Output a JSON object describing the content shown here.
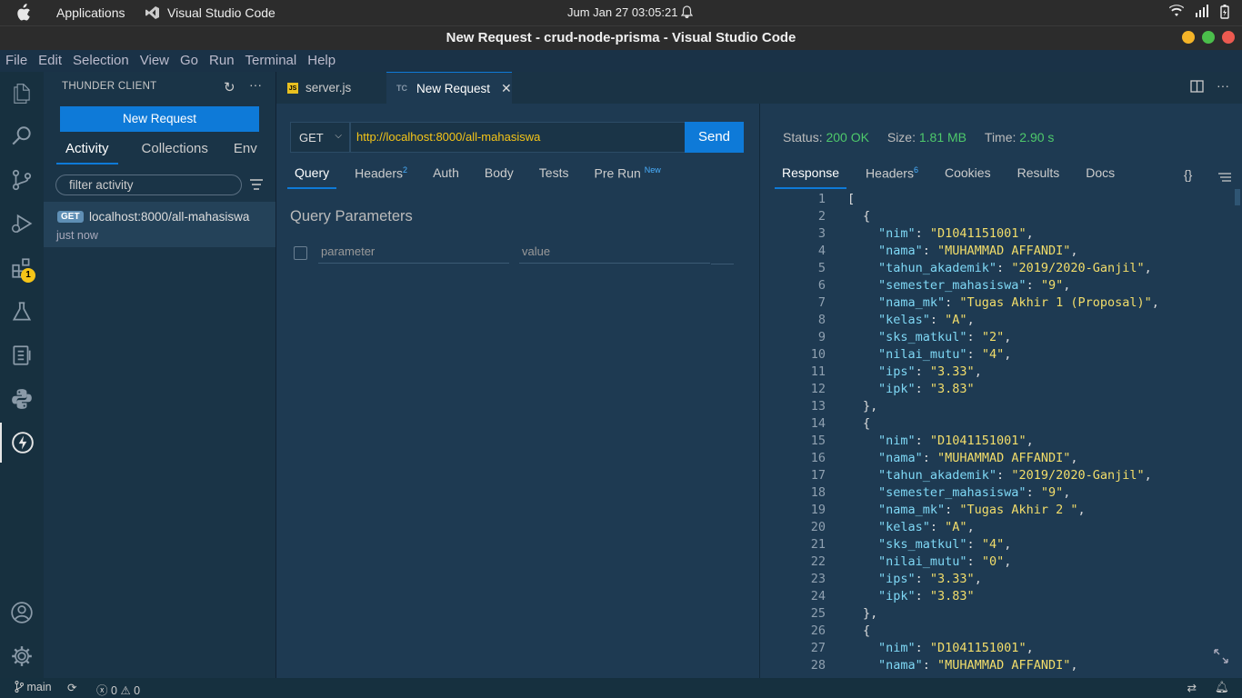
{
  "system": {
    "applications": "Applications",
    "app_name": "Visual Studio Code",
    "clock": "Jum Jan 27  03:05:21"
  },
  "window": {
    "title": "New Request - crud-node-prisma - Visual Studio Code"
  },
  "menu": [
    "File",
    "Edit",
    "Selection",
    "View",
    "Go",
    "Run",
    "Terminal",
    "Help"
  ],
  "activity_bar": {
    "extensions_badge": "1"
  },
  "sidebar": {
    "title": "THUNDER CLIENT",
    "new_request": "New Request",
    "tabs": [
      "Activity",
      "Collections",
      "Env"
    ],
    "filter_placeholder": "filter activity",
    "activity_item": {
      "method": "GET",
      "url": "localhost:8000/all-mahasiswa",
      "time": "just now"
    }
  },
  "editor_tabs": [
    {
      "icon": "JS",
      "label": "server.js"
    },
    {
      "icon": "TC",
      "label": "New Request"
    }
  ],
  "request": {
    "method": "GET",
    "url": "http://localhost:8000/all-mahasiswa",
    "send": "Send",
    "tabs": [
      {
        "label": "Query",
        "sup": ""
      },
      {
        "label": "Headers",
        "sup": "2"
      },
      {
        "label": "Auth",
        "sup": ""
      },
      {
        "label": "Body",
        "sup": ""
      },
      {
        "label": "Tests",
        "sup": ""
      },
      {
        "label": "Pre Run",
        "sup": "New"
      }
    ],
    "query_title": "Query Parameters",
    "param_placeholder": "parameter",
    "value_placeholder": "value"
  },
  "response": {
    "status_label": "Status:",
    "status": "200 OK",
    "size_label": "Size:",
    "size": "1.81 MB",
    "time_label": "Time:",
    "time": "2.90 s",
    "tabs": [
      {
        "label": "Response",
        "sup": ""
      },
      {
        "label": "Headers",
        "sup": "6"
      },
      {
        "label": "Cookies",
        "sup": ""
      },
      {
        "label": "Results",
        "sup": ""
      },
      {
        "label": "Docs",
        "sup": ""
      }
    ],
    "braces": "{}",
    "lines": [
      {
        "n": "1",
        "t": "[",
        "indent": 0
      },
      {
        "n": "2",
        "t": "{",
        "indent": 1
      },
      {
        "n": "3",
        "k": "nim",
        "v": "D1041151001",
        "indent": 2,
        "comma": true
      },
      {
        "n": "4",
        "k": "nama",
        "v": "MUHAMMAD AFFANDI",
        "indent": 2,
        "comma": true
      },
      {
        "n": "5",
        "k": "tahun_akademik",
        "v": "2019/2020-Ganjil",
        "indent": 2,
        "comma": true
      },
      {
        "n": "6",
        "k": "semester_mahasiswa",
        "v": "9",
        "indent": 2,
        "comma": true
      },
      {
        "n": "7",
        "k": "nama_mk",
        "v": "Tugas Akhir 1 (Proposal)",
        "indent": 2,
        "comma": true
      },
      {
        "n": "8",
        "k": "kelas",
        "v": "A",
        "indent": 2,
        "comma": true
      },
      {
        "n": "9",
        "k": "sks_matkul",
        "v": "2",
        "indent": 2,
        "comma": true
      },
      {
        "n": "10",
        "k": "nilai_mutu",
        "v": "4",
        "indent": 2,
        "comma": true
      },
      {
        "n": "11",
        "k": "ips",
        "v": "3.33",
        "indent": 2,
        "comma": true
      },
      {
        "n": "12",
        "k": "ipk",
        "v": "3.83",
        "indent": 2,
        "comma": false
      },
      {
        "n": "13",
        "t": "},",
        "indent": 1
      },
      {
        "n": "14",
        "t": "{",
        "indent": 1
      },
      {
        "n": "15",
        "k": "nim",
        "v": "D1041151001",
        "indent": 2,
        "comma": true
      },
      {
        "n": "16",
        "k": "nama",
        "v": "MUHAMMAD AFFANDI",
        "indent": 2,
        "comma": true
      },
      {
        "n": "17",
        "k": "tahun_akademik",
        "v": "2019/2020-Ganjil",
        "indent": 2,
        "comma": true
      },
      {
        "n": "18",
        "k": "semester_mahasiswa",
        "v": "9",
        "indent": 2,
        "comma": true
      },
      {
        "n": "19",
        "k": "nama_mk",
        "v": "Tugas Akhir 2 ",
        "indent": 2,
        "comma": true
      },
      {
        "n": "20",
        "k": "kelas",
        "v": "A",
        "indent": 2,
        "comma": true
      },
      {
        "n": "21",
        "k": "sks_matkul",
        "v": "4",
        "indent": 2,
        "comma": true
      },
      {
        "n": "22",
        "k": "nilai_mutu",
        "v": "0",
        "indent": 2,
        "comma": true
      },
      {
        "n": "23",
        "k": "ips",
        "v": "3.33",
        "indent": 2,
        "comma": true
      },
      {
        "n": "24",
        "k": "ipk",
        "v": "3.83",
        "indent": 2,
        "comma": false
      },
      {
        "n": "25",
        "t": "},",
        "indent": 1
      },
      {
        "n": "26",
        "t": "{",
        "indent": 1
      },
      {
        "n": "27",
        "k": "nim",
        "v": "D1041151001",
        "indent": 2,
        "comma": true
      },
      {
        "n": "28",
        "k": "nama",
        "v": "MUHAMMAD AFFANDI",
        "indent": 2,
        "comma": true
      }
    ]
  },
  "statusbar": {
    "branch": "main",
    "errors": "0",
    "warnings": "0"
  },
  "colors": {
    "accent": "#0e7ad8",
    "status_ok": "#4ec96b",
    "json_key": "#7fd8f5",
    "json_string": "#f2dd6a"
  }
}
